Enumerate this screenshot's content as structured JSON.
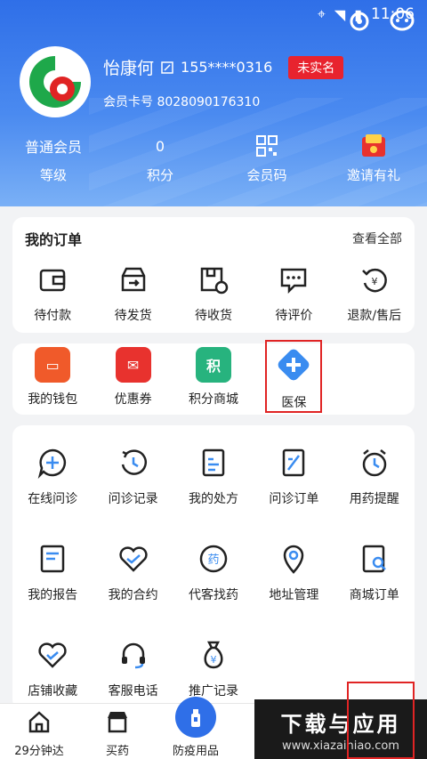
{
  "status": {
    "time": "11:06"
  },
  "profile": {
    "name": "怡康何",
    "phone": "155****0316",
    "verify_badge": "未实名",
    "card_label": "会员卡号 8028090176310"
  },
  "stats": [
    {
      "value": "普通会员",
      "label": "等级"
    },
    {
      "value": "0",
      "label": "积分"
    },
    {
      "value": "",
      "label": "会员码"
    },
    {
      "value": "",
      "label": "邀请有礼"
    }
  ],
  "orders": {
    "title": "我的订单",
    "view_all": "查看全部",
    "items": [
      {
        "label": "待付款",
        "icon": "wallet-icon"
      },
      {
        "label": "待发货",
        "icon": "box-icon"
      },
      {
        "label": "待收货",
        "icon": "receive-icon"
      },
      {
        "label": "待评价",
        "icon": "comment-icon"
      },
      {
        "label": "退款/售后",
        "icon": "refund-icon"
      }
    ]
  },
  "wallet": [
    {
      "label": "我的钱包",
      "color": "#f05a2a"
    },
    {
      "label": "优惠券",
      "color": "#e8322e"
    },
    {
      "label": "积分商城",
      "color": "#27b37e",
      "glyph": "积"
    },
    {
      "label": "医保",
      "color": "#3a8cf0"
    }
  ],
  "services": [
    {
      "label": "在线问诊"
    },
    {
      "label": "问诊记录"
    },
    {
      "label": "我的处方"
    },
    {
      "label": "问诊订单"
    },
    {
      "label": "用药提醒"
    },
    {
      "label": "我的报告"
    },
    {
      "label": "我的合约"
    },
    {
      "label": "代客找药"
    },
    {
      "label": "地址管理"
    },
    {
      "label": "商城订单"
    },
    {
      "label": "店铺收藏"
    },
    {
      "label": "客服电话"
    },
    {
      "label": "推广记录"
    }
  ],
  "tabs": [
    {
      "label": "29分钟达"
    },
    {
      "label": "买药"
    },
    {
      "label": "防疫用品"
    }
  ],
  "watermark": {
    "main": "下载与应用",
    "sub": "www.xiazainiao.com"
  },
  "colors": {
    "primary": "#2f6fe8",
    "accent_red": "#e8232e"
  }
}
